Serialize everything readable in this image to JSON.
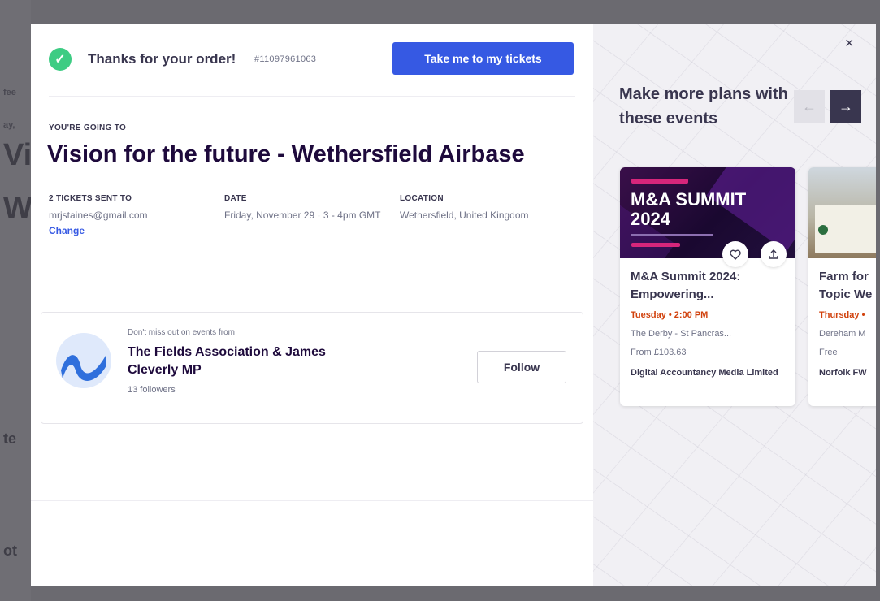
{
  "background": {
    "fragments": [
      "fee",
      "ay,",
      "Vis",
      "We",
      "te",
      "ot"
    ]
  },
  "confirmation": {
    "check_glyph": "✓",
    "thanks_text": "Thanks for your order!",
    "order_number": "#11097961063",
    "tickets_button": "Take me to my tickets"
  },
  "event": {
    "going_to_label": "YOU'RE GOING TO",
    "title": "Vision for the future - Wethersfield Airbase",
    "tickets_label": "2 TICKETS SENT TO",
    "email": "mrjstaines@gmail.com",
    "change_link": "Change",
    "date_label": "DATE",
    "date_value": "Friday, November 29 · 3 - 4pm GMT",
    "location_label": "LOCATION",
    "location_value": "Wethersfield, United Kingdom"
  },
  "organizer": {
    "dont_miss": "Don't miss out on events from",
    "name": "The Fields Association & James Cleverly MP",
    "followers": "13 followers",
    "follow_button": "Follow"
  },
  "recommendations": {
    "close_glyph": "×",
    "title": "Make more plans with these events",
    "prev_glyph": "←",
    "next_glyph": "→",
    "cards": [
      {
        "image_text": "M&A SUMMIT 2024",
        "title": "M&A Summit 2024: Empowering...",
        "date": "Tuesday • 2:00 PM",
        "venue": "The Derby - St Pancras...",
        "price": "From £103.63",
        "organizer": "Digital Accountancy Media Limited"
      },
      {
        "title": "Farm for Topic We",
        "date": "Thursday •",
        "venue": "Dereham M",
        "price": "Free",
        "organizer": "Norfolk FW"
      }
    ]
  },
  "colors": {
    "primary_button": "#3659e3",
    "success": "#3dcc83",
    "date_accent": "#d1410c",
    "title_text": "#1e0a3c"
  }
}
